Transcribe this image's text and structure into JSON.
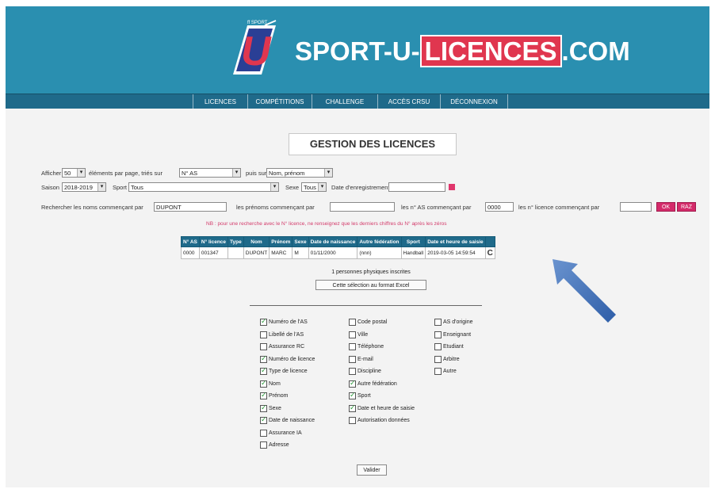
{
  "header": {
    "logo_small": "ff SPORT",
    "brand_left": "SPORT-U-",
    "brand_highlight": "LICENCES",
    "brand_right": ".COM",
    "brand_color": "#2a8fb0"
  },
  "nav": {
    "items": [
      "LICENCES",
      "COMPÉTITIONS",
      "CHALLENGE",
      "ACCÈS CRSU",
      "DÉCONNEXION"
    ]
  },
  "page_title": "GESTION DES LICENCES",
  "filters": {
    "row1": {
      "afficher_label": "Afficher",
      "per_page": "50",
      "per_page_label": "éléments par page, triés sur",
      "sort1": "N° AS",
      "sort2_label": "puis sur",
      "sort2": "Nom, prénom"
    },
    "row2": {
      "season_label": "Saison",
      "season": "2018-2019",
      "sport_label": "Sport",
      "sport": "Tous",
      "sex_label": "Sexe",
      "sex": "Tous",
      "date_label": "Date d'enregistrement",
      "date_value": ""
    },
    "row3": {
      "search_label": "Rechercher les noms commençant par",
      "search_value": "DUPONT",
      "prenom_label": "les prénoms commençant par",
      "prenom_value": "",
      "as_label": "les n° AS commençant par",
      "as_value": "0000",
      "licence_label": "les n° licence commençant par",
      "licence_value": "",
      "ok_label": "OK",
      "raz_label": "RAZ"
    },
    "note": "NB : pour une recherche avec le N° licence, ne renseignez que les derniers chiffres du N° après les zéros"
  },
  "table": {
    "headers": [
      "N° AS",
      "N° licence",
      "Type",
      "Nom",
      "Prénom",
      "Sexe",
      "Date de naissance",
      "Autre fédération",
      "Sport",
      "Date et heure de saisie"
    ],
    "rows": [
      [
        "0000",
        "001347",
        "",
        "DUPONT",
        "MARC",
        "M",
        "01/11/2000",
        "(nnn)",
        "Handball",
        "2019-03-05 14:59:54"
      ]
    ],
    "refresh_icon": "C"
  },
  "summary": {
    "count_text": "1 personnes physiques inscrites",
    "export_label": "Cette sélection au format Excel"
  },
  "columns": {
    "col1": [
      {
        "label": "Numéro de l'AS",
        "checked": true
      },
      {
        "label": "Libellé de l'AS",
        "checked": false
      },
      {
        "label": "Assurance RC",
        "checked": false
      },
      {
        "label": "Numéro de licence",
        "checked": true
      },
      {
        "label": "Type de licence",
        "checked": true
      },
      {
        "label": "Nom",
        "checked": true
      },
      {
        "label": "Prénom",
        "checked": true
      },
      {
        "label": "Sexe",
        "checked": true
      },
      {
        "label": "Date de naissance",
        "checked": true
      },
      {
        "label": "Assurance IA",
        "checked": false
      },
      {
        "label": "Adresse",
        "checked": false
      }
    ],
    "col2": [
      {
        "label": "Code postal",
        "checked": false
      },
      {
        "label": "Ville",
        "checked": false
      },
      {
        "label": "Téléphone",
        "checked": false
      },
      {
        "label": "E-mail",
        "checked": false
      },
      {
        "label": "Discipline",
        "checked": false
      },
      {
        "label": "Autre fédération",
        "checked": true
      },
      {
        "label": "Sport",
        "checked": true
      },
      {
        "label": "Date et heure de saisie",
        "checked": true
      },
      {
        "label": "Autorisation données",
        "checked": false
      }
    ],
    "col3": [
      {
        "label": "AS d'origine",
        "checked": false
      },
      {
        "label": "Enseignant",
        "checked": false
      },
      {
        "label": "Etudiant",
        "checked": false
      },
      {
        "label": "Arbitre",
        "checked": false
      },
      {
        "label": "Autre",
        "checked": false
      }
    ]
  },
  "validate_label": "Valider",
  "arrow_color": "#3b6fb5"
}
